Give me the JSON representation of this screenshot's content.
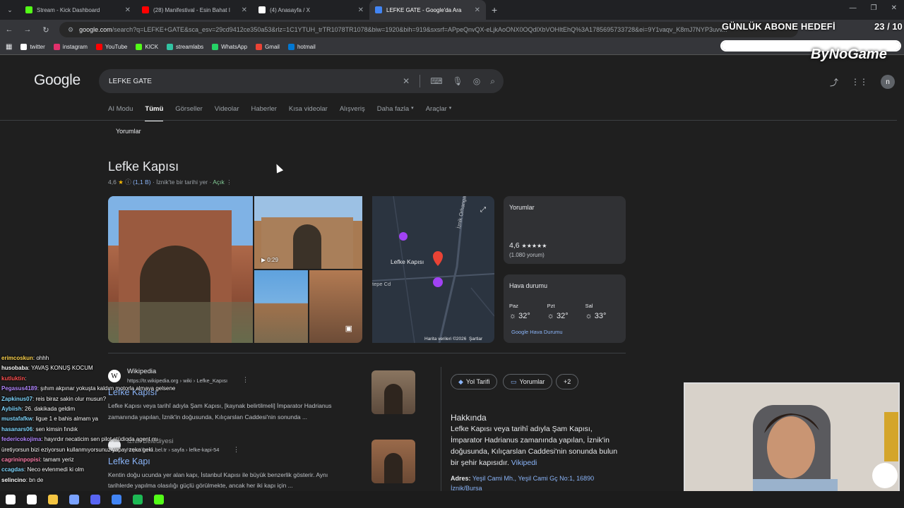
{
  "browser": {
    "tabs": [
      {
        "title": "Stream - Kick Dashboard",
        "color": "#53fc18",
        "active": false
      },
      {
        "title": "(28) Manifestival - Esin Bahat I",
        "color": "#ff0000",
        "active": false
      },
      {
        "title": "(4) Anasayfa / X",
        "color": "#ffffff",
        "active": false
      },
      {
        "title": "LEFKE GATE - Google'da Ara",
        "color": "#4285f4",
        "active": true
      }
    ],
    "url_host": "google.com",
    "url_rest": "/search?q=LEFKE+GATE&sca_esv=29cd9412ce350a53&rlz=1C1YTUH_trTR1078TR1078&biw=1920&bih=919&sxsrf=APpeQnvQX-eLjkAoONX0OQdlXbVOHItEhQ%3A1785695733728&ei=9Y1vaqv_K8mJ7NYP3uvv...",
    "bookmarks": [
      {
        "label": "twitter",
        "color": "#ffffff"
      },
      {
        "label": "instagram",
        "color": "#e1306c"
      },
      {
        "label": "YouTube",
        "color": "#ff0000"
      },
      {
        "label": "KICK",
        "color": "#53fc18"
      },
      {
        "label": "streamlabs",
        "color": "#31c3a2"
      },
      {
        "label": "WhatsApp",
        "color": "#25d366"
      },
      {
        "label": "Gmail",
        "color": "#ea4335"
      },
      {
        "label": "hotmail",
        "color": "#0078d4"
      }
    ]
  },
  "overlay": {
    "goal_label": "GÜNLÜK ABONE HEDEFİ",
    "count": "23 / 10",
    "goal_progress": 1.0,
    "logo": "ByNoGame"
  },
  "google": {
    "logo": "Google",
    "query": "LEFKE GATE",
    "avatar_letter": "n",
    "tabs": [
      "AI Modu",
      "Tümü",
      "Görseller",
      "Videolar",
      "Haberler",
      "Kısa videolar",
      "Alışveriş",
      "Daha fazla",
      "Araçlar"
    ],
    "chip": "Yorumlar"
  },
  "result": {
    "title": "Lefke Kapısı",
    "rating": "4,6",
    "rating_count": "(1,1 B)",
    "category": "İznik'te bir tarihi yer",
    "status": "Açık",
    "video_duration": "0:29",
    "map_label": "Lefke Kapısı",
    "map_street1": "İznik Orhangazi Yolu",
    "map_street2": "tepe Cd",
    "map_credit": "Harita verileri ©2026",
    "map_terms": "Şartlar",
    "reviews_card": {
      "title": "Yorumlar",
      "rating": "4,6",
      "stars": "★★★★★",
      "count": "(1.080 yorum)"
    },
    "weather_card": {
      "title": "Hava durumu",
      "days": [
        {
          "day": "Paz",
          "temp": "32°"
        },
        {
          "day": "Pzt",
          "temp": "32°"
        },
        {
          "day": "Sal",
          "temp": "33°"
        }
      ],
      "link": "Google Hava Durumu"
    }
  },
  "web_results": [
    {
      "source": "Wikipedia",
      "url": "https://tr.wikipedia.org › wiki › Lefke_Kapısı",
      "title": "Lefke Kapısı",
      "snippet_line1": "Lefke Kapısı veya tarihî adıyla Şam Kapısı, [kaynak belirtilmeli] İmparator Hadrianus",
      "snippet_line2": "zamanında yapılan, İznik'in doğusunda, Kılıçarslan Caddesi'nin sonunda ..."
    },
    {
      "source": "İznik Belediyesi",
      "url": "https://iznik.bel.tr › sayfa › lefke-kapi-54",
      "title": "Lefke Kapı",
      "snippet_line1": "Kentin doğu ucunda yer alan kapı, İstanbul Kapısı ile büyük benzerlik gösterir. Aynı",
      "snippet_line2": "tarihlerde yapılma olasılığı güçlü görülmekte, ancak her iki kapı için ..."
    }
  ],
  "knowledge": {
    "actions": [
      "Yol Tarifi",
      "Yorumlar",
      "+2"
    ],
    "about_title": "Hakkında",
    "about_lines": [
      "Lefke Kapısı veya tarihî adıyla Şam Kapısı,",
      "İmparator Hadrianus zamanında yapılan, İznik'in",
      "doğusunda, Kılıçarslan Caddesi'nin sonunda bulun",
      "bir şehir kapısıdır."
    ],
    "about_link": "Vikipedi",
    "address_label": "Adres:",
    "address_value": "Yeşil Cami Mh., Yeşil Cami Gç No:1, 16890",
    "address_line2": "İznik/Bursa"
  },
  "chat": [
    {
      "user": "erimcoskun",
      "color": "#ffd54f",
      "msg": ": ohhh"
    },
    {
      "user": "husobaba",
      "color": "#ffffff",
      "msg": ": YAVAŞ KONUŞ KOCUM"
    },
    {
      "user": "kutluktin",
      "color": "#ff5252",
      "msg": ":"
    },
    {
      "user": "Pegasus4189",
      "color": "#b388ff",
      "msg": ": şıhım akpınar yokuşta kaldım motorla almaya gelsene"
    },
    {
      "user": "Zapkinus07",
      "color": "#80d8ff",
      "msg": ": reis biraz sakin olur musun?"
    },
    {
      "user": "Aybiish",
      "color": "#80d8ff",
      "msg": ": 26. dakikada geldim"
    },
    {
      "user": "mustafafkw",
      "color": "#80d8ff",
      "msg": ": ligue 1 e bahis almam ya"
    },
    {
      "user": "hasanars06",
      "color": "#80d8ff",
      "msg": ": sen kimsin fındık"
    },
    {
      "user": "federicokojima",
      "color": "#b388ff",
      "msg": ": hayırdır necaticim sen pilot stüdioda agent mı"
    },
    {
      "user": "",
      "color": "#ffffff",
      "msg": "üretiyorsun bizi eziyorsun kullanmıyorsunuz yapay zeka geki"
    },
    {
      "user": "cagrininpopisi",
      "color": "#ff80ab",
      "msg": ": tamam yeriz"
    },
    {
      "user": "ccagdas",
      "color": "#80d8ff",
      "msg": ": Neco evlenmedi ki olm"
    },
    {
      "user": "selincino",
      "color": "#ffffff",
      "msg": ": bn de"
    }
  ],
  "taskbar": [
    "start",
    "search",
    "explorer",
    "app1",
    "discord",
    "chrome",
    "spotify",
    "kick"
  ]
}
